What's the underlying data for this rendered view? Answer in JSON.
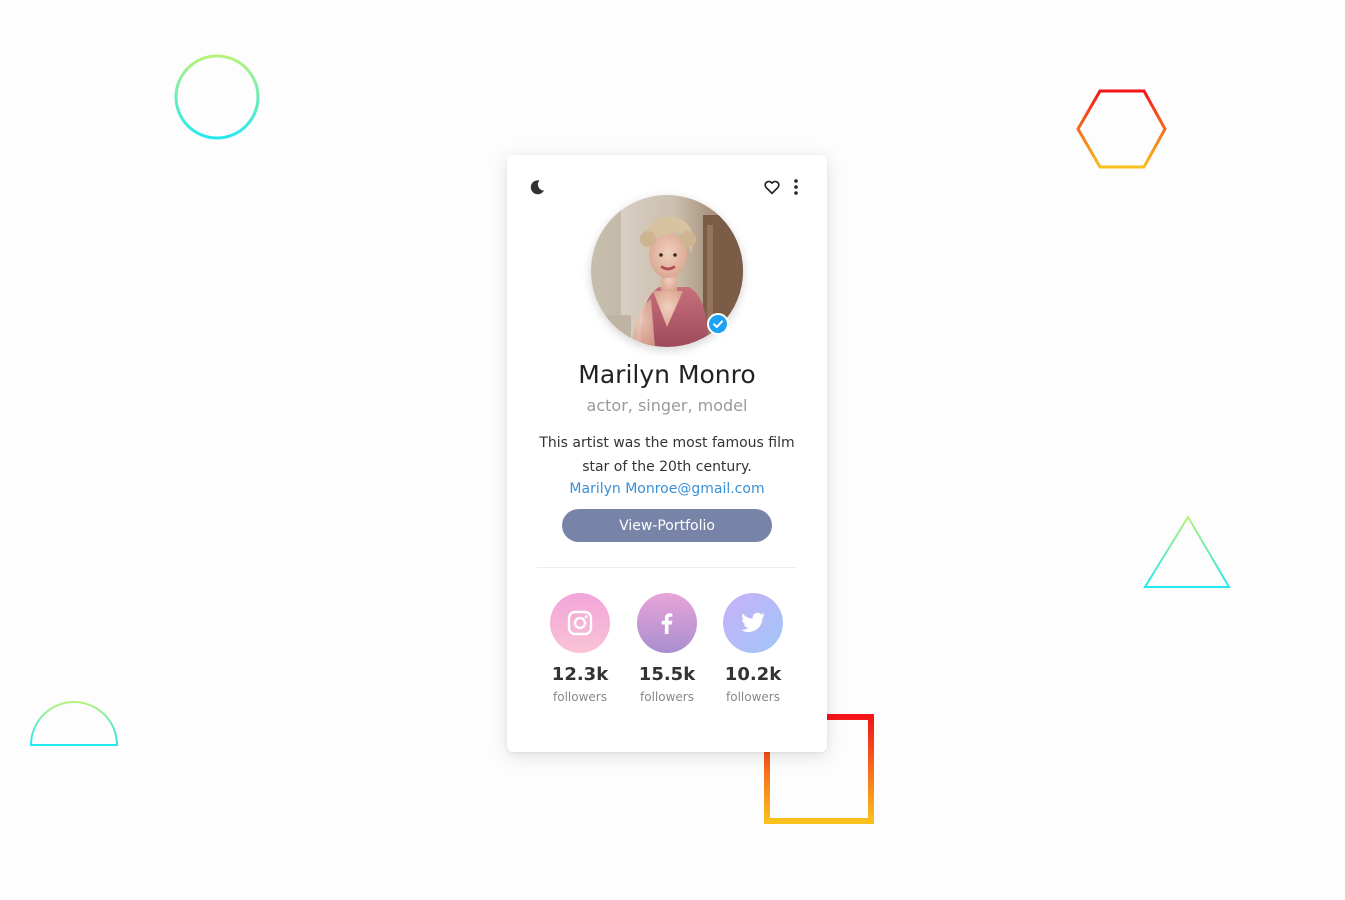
{
  "profile": {
    "name": "Marilyn Monro",
    "role": "actor, singer, model",
    "bio": "This artist was the most famous film star of the 20th century.",
    "email": "Marilyn Monroe@gmail.com",
    "portfolio_button": "View-Portfolio"
  },
  "socials": [
    {
      "network": "instagram",
      "icon": "instagram-icon",
      "count": "12.3k",
      "label": "followers"
    },
    {
      "network": "facebook",
      "icon": "facebook-icon",
      "count": "15.5k",
      "label": "followers"
    },
    {
      "network": "twitter",
      "icon": "twitter-icon",
      "count": "10.2k",
      "label": "followers"
    }
  ],
  "icons": {
    "theme_toggle": "moon-icon",
    "favorite": "heart-icon",
    "menu": "more-vertical-icon",
    "verified": "verified-check-icon"
  },
  "colors": {
    "button": "#7784a8",
    "email_link": "#3b8fd6",
    "verified": "#1da1f2"
  }
}
